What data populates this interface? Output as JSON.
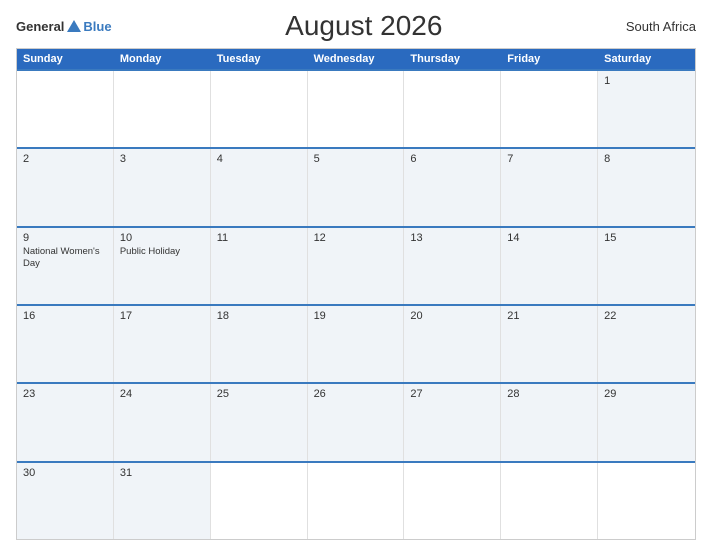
{
  "header": {
    "logo_general": "General",
    "logo_blue": "Blue",
    "title": "August 2026",
    "country": "South Africa"
  },
  "days_of_week": [
    "Sunday",
    "Monday",
    "Tuesday",
    "Wednesday",
    "Thursday",
    "Friday",
    "Saturday"
  ],
  "weeks": [
    [
      {
        "day": "",
        "empty": true
      },
      {
        "day": "",
        "empty": true
      },
      {
        "day": "",
        "empty": true
      },
      {
        "day": "",
        "empty": true
      },
      {
        "day": "",
        "empty": true
      },
      {
        "day": "",
        "empty": true
      },
      {
        "day": "1",
        "events": []
      }
    ],
    [
      {
        "day": "2",
        "events": []
      },
      {
        "day": "3",
        "events": []
      },
      {
        "day": "4",
        "events": []
      },
      {
        "day": "5",
        "events": []
      },
      {
        "day": "6",
        "events": []
      },
      {
        "day": "7",
        "events": []
      },
      {
        "day": "8",
        "events": []
      }
    ],
    [
      {
        "day": "9",
        "events": [
          "National Women's Day"
        ]
      },
      {
        "day": "10",
        "events": [
          "Public Holiday"
        ]
      },
      {
        "day": "11",
        "events": []
      },
      {
        "day": "12",
        "events": []
      },
      {
        "day": "13",
        "events": []
      },
      {
        "day": "14",
        "events": []
      },
      {
        "day": "15",
        "events": []
      }
    ],
    [
      {
        "day": "16",
        "events": []
      },
      {
        "day": "17",
        "events": []
      },
      {
        "day": "18",
        "events": []
      },
      {
        "day": "19",
        "events": []
      },
      {
        "day": "20",
        "events": []
      },
      {
        "day": "21",
        "events": []
      },
      {
        "day": "22",
        "events": []
      }
    ],
    [
      {
        "day": "23",
        "events": []
      },
      {
        "day": "24",
        "events": []
      },
      {
        "day": "25",
        "events": []
      },
      {
        "day": "26",
        "events": []
      },
      {
        "day": "27",
        "events": []
      },
      {
        "day": "28",
        "events": []
      },
      {
        "day": "29",
        "events": []
      }
    ],
    [
      {
        "day": "30",
        "events": []
      },
      {
        "day": "31",
        "events": []
      },
      {
        "day": "",
        "empty": true
      },
      {
        "day": "",
        "empty": true
      },
      {
        "day": "",
        "empty": true
      },
      {
        "day": "",
        "empty": true
      },
      {
        "day": "",
        "empty": true
      }
    ]
  ]
}
